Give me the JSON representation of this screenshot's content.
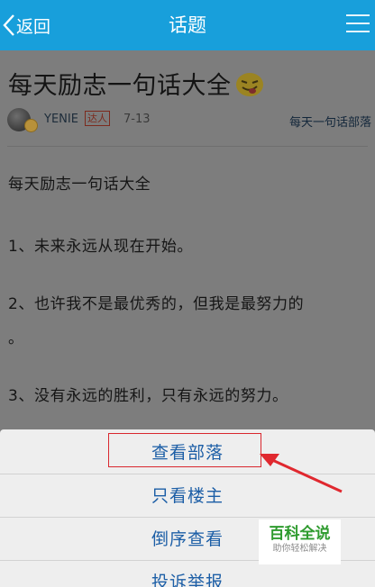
{
  "header": {
    "back_label": "返回",
    "title": "话题"
  },
  "article": {
    "title": "每天励志一句话大全",
    "author": "YENIE",
    "author_badge": "达人",
    "date": "7-13",
    "tribe": "每天一句话部落",
    "paragraphs": [
      "每天励志一句话大全",
      "1、未来永远从现在开始。",
      "2、也许我不是最优秀的，但我是最努力的",
      "。",
      "3、没有永远的胜利，只有永远的努力。"
    ]
  },
  "action_sheet": {
    "items": [
      "查看部落",
      "只看楼主",
      "倒序查看",
      "投诉举报"
    ]
  },
  "watermark": {
    "main": "百科全说",
    "sub": "助你轻松解决"
  },
  "colors": {
    "header_bg": "#189fdb",
    "sheet_text": "#1c5ea6",
    "annotation_red": "#d9272e",
    "watermark_green": "#2e9b2e"
  }
}
